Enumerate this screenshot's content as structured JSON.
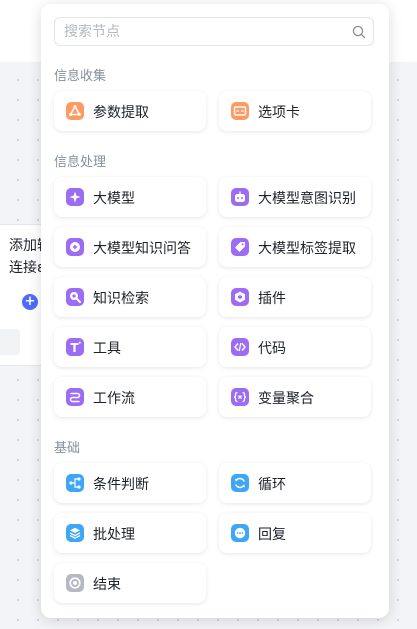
{
  "background_node": {
    "line1": "添加输",
    "line2": "连接ε"
  },
  "search": {
    "placeholder": "搜索节点"
  },
  "sections": [
    {
      "title": "信息收集",
      "items": [
        {
          "label": "参数提取",
          "icon": "parameter-extract-icon",
          "color": "#ff9a62"
        },
        {
          "label": "选项卡",
          "icon": "option-card-icon",
          "color": "#ff9a62"
        }
      ]
    },
    {
      "title": "信息处理",
      "items": [
        {
          "label": "大模型",
          "icon": "sparkle-icon",
          "color": "#9c6cf5"
        },
        {
          "label": "大模型意图识别",
          "icon": "robot-icon",
          "color": "#9c6cf5"
        },
        {
          "label": "大模型知识问答",
          "icon": "knowledge-qa-icon",
          "color": "#9c6cf5"
        },
        {
          "label": "大模型标签提取",
          "icon": "tag-icon",
          "color": "#9c6cf5"
        },
        {
          "label": "知识检索",
          "icon": "knowledge-search-icon",
          "color": "#9c6cf5"
        },
        {
          "label": "插件",
          "icon": "plugin-icon",
          "color": "#9c6cf5"
        },
        {
          "label": "工具",
          "icon": "tool-icon",
          "color": "#9c6cf5"
        },
        {
          "label": "代码",
          "icon": "code-icon",
          "color": "#9c6cf5"
        },
        {
          "label": "工作流",
          "icon": "workflow-icon",
          "color": "#9c6cf5"
        },
        {
          "label": "变量聚合",
          "icon": "variable-aggregate-icon",
          "color": "#9c6cf5"
        }
      ]
    },
    {
      "title": "基础",
      "items": [
        {
          "label": "条件判断",
          "icon": "condition-icon",
          "color": "#3ea7f5"
        },
        {
          "label": "循环",
          "icon": "loop-icon",
          "color": "#3ea7f5"
        },
        {
          "label": "批处理",
          "icon": "batch-icon",
          "color": "#3ea7f5"
        },
        {
          "label": "回复",
          "icon": "reply-icon",
          "color": "#3ea7f5"
        },
        {
          "label": "结束",
          "icon": "end-icon",
          "color": "#b6b9c3"
        }
      ]
    }
  ]
}
